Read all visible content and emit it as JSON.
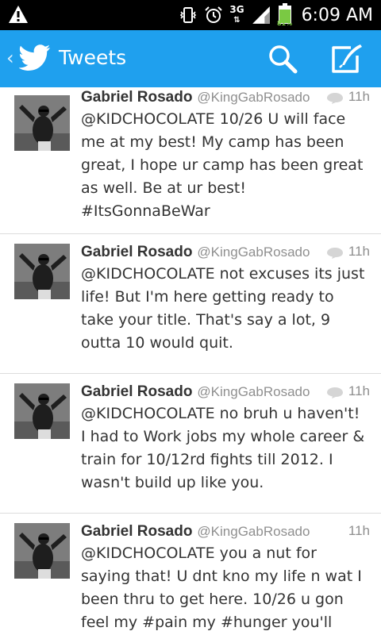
{
  "status_bar": {
    "time": "6:09 AM",
    "network": "3G",
    "battery_pct": "81%",
    "icons": [
      "warning-icon",
      "vibrate-icon",
      "alarm-icon",
      "signal-icon",
      "battery-icon"
    ]
  },
  "action_bar": {
    "title": "Tweets",
    "icons": [
      "back-chevron-icon",
      "twitter-bird-icon",
      "search-icon",
      "compose-icon"
    ],
    "color": "#1fa0ee"
  },
  "tweets": [
    {
      "name": "Gabriel Rosado",
      "handle": "@KingGabRosado",
      "time": "11h",
      "text": "@KIDCHOCOLATE 10/26 U will face me at my best! My camp has been great, I hope ur camp has been great as well. Be at ur best! #ItsGonnaBeWar"
    },
    {
      "name": "Gabriel Rosado",
      "handle": "@KingGabRosado",
      "time": "11h",
      "text": "@KIDCHOCOLATE not excuses its just life! But I'm here getting ready to take your title. That's say a lot, 9 outta 10 would quit."
    },
    {
      "name": "Gabriel Rosado",
      "handle": "@KingGabRosado",
      "time": "11h",
      "text": "@KIDCHOCOLATE no bruh u haven't! I had to Work jobs my whole career & train for 10/12rd fights till 2012. I wasn't build up like you."
    },
    {
      "name": "Gabriel Rosado",
      "handle": "@KingGabRosado",
      "time": "11h",
      "text": "@KIDCHOCOLATE you a nut for saying that! U dnt kno my life n wat I been thru to get here. 10/26 u gon feel my #pain my #hunger you'll see!"
    }
  ]
}
